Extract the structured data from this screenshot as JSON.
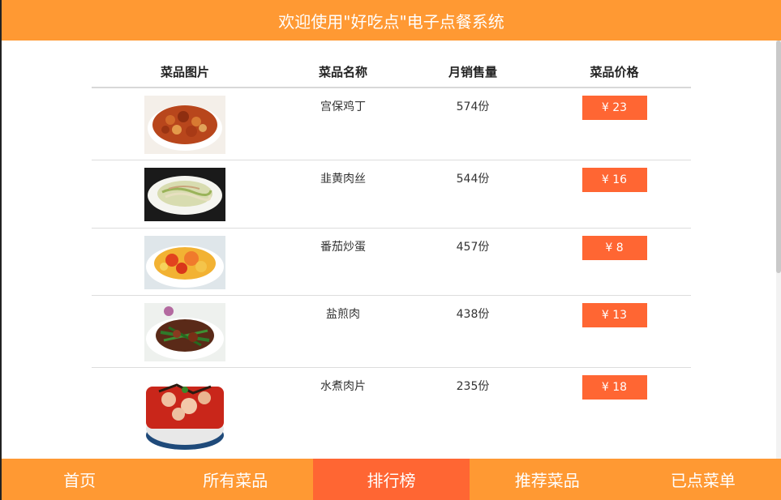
{
  "header": {
    "title": "欢迎使用\"好吃点\"电子点餐系统"
  },
  "table": {
    "columns": [
      "菜品图片",
      "菜品名称",
      "月销售量",
      "菜品价格"
    ],
    "rows": [
      {
        "name": "宫保鸡丁",
        "sales": "574份",
        "price": "¥ 23",
        "image_icon": "dish-kungpao-icon"
      },
      {
        "name": "韭黄肉丝",
        "sales": "544份",
        "price": "¥ 16",
        "image_icon": "dish-chives-pork-icon"
      },
      {
        "name": "番茄炒蛋",
        "sales": "457份",
        "price": "¥ 8",
        "image_icon": "dish-tomato-egg-icon"
      },
      {
        "name": "盐煎肉",
        "sales": "438份",
        "price": "¥ 13",
        "image_icon": "dish-salt-pork-icon"
      },
      {
        "name": "水煮肉片",
        "sales": "235份",
        "price": "¥ 18",
        "image_icon": "dish-boiled-pork-icon"
      }
    ]
  },
  "footer": {
    "items": [
      "首页",
      "所有菜品",
      "排行榜",
      "推荐菜品",
      "已点菜单"
    ],
    "active_index": 2
  },
  "colors": {
    "header_bg": "#ff9933",
    "accent": "#ff6633",
    "footer_bg": "#ff9933"
  }
}
